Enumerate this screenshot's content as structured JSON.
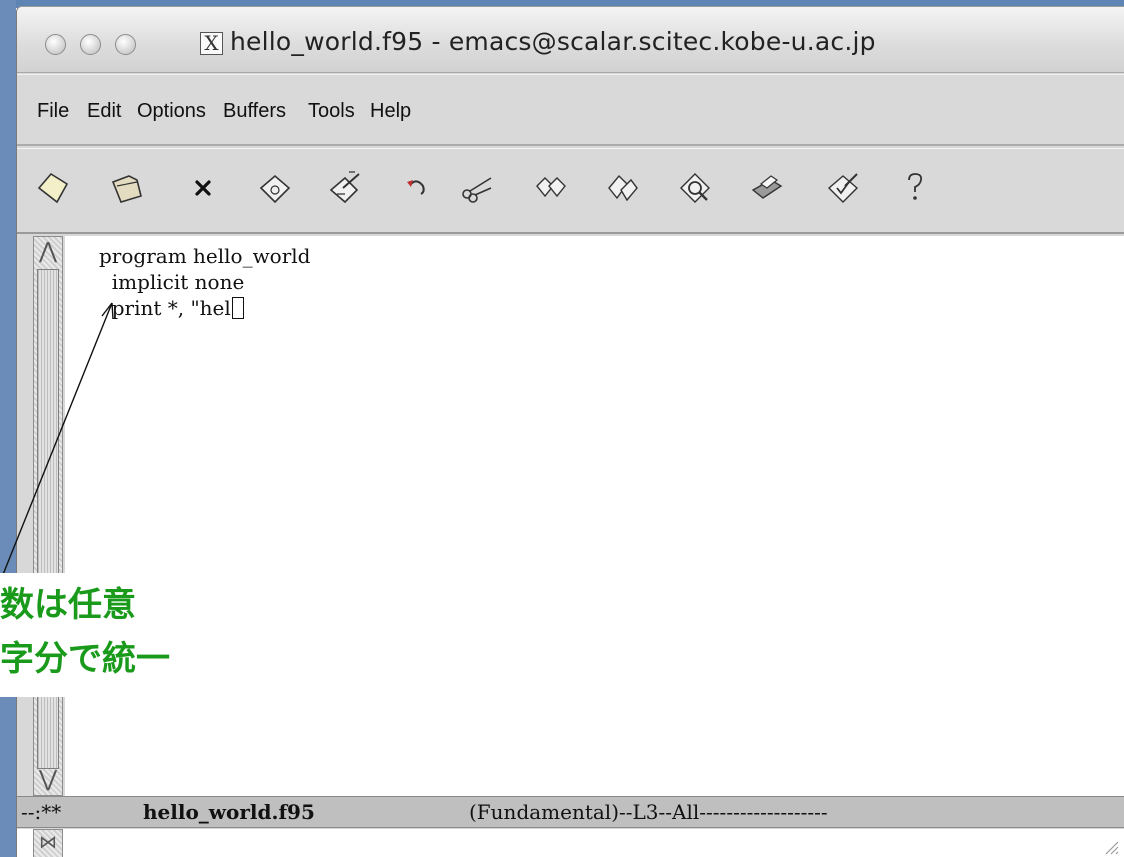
{
  "window": {
    "title": "hello_world.f95 - emacs@scalar.scitec.kobe-u.ac.jp",
    "app_icon": "x11-icon",
    "x_glyph": "X"
  },
  "menubar": {
    "items": [
      "File",
      "Edit",
      "Options",
      "Buffers",
      "Tools",
      "Help"
    ]
  },
  "toolbar": {
    "icons": [
      "new-file-icon",
      "open-folder-icon",
      "close-icon",
      "save-disk-icon",
      "save-as-icon",
      "undo-icon",
      "cut-scissors-icon",
      "copy-icon",
      "paste-icon",
      "search-icon",
      "print-icon",
      "spell-check-icon",
      "help-icon"
    ]
  },
  "editor": {
    "lines": [
      "program hello_world",
      "  implicit none",
      "  print *, \"hel"
    ]
  },
  "modeline": {
    "prefix": "--:**",
    "buffer_name": "hello_world.f95",
    "mode_info": "(Fundamental)--L3--All-------------------"
  },
  "annotation": {
    "line1": "数は任意",
    "line2": "字分で統一",
    "color": "#1a9a1a"
  }
}
